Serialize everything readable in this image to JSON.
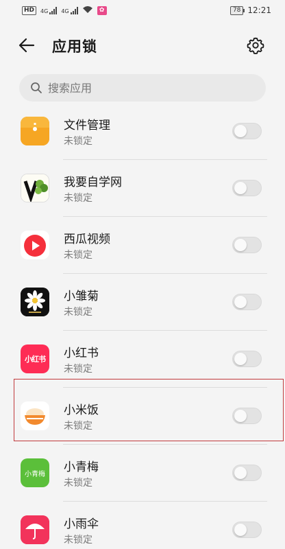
{
  "status_bar": {
    "hd_label": "HD",
    "network_1": "4G",
    "network_2": "4G",
    "battery_level": "78",
    "time": "12:21",
    "notification_badge_color": "#e84a8a"
  },
  "header": {
    "title": "应用锁",
    "back_icon": "arrow-left-icon",
    "settings_icon": "gear-icon"
  },
  "search": {
    "placeholder": "搜索应用",
    "value": ""
  },
  "apps": [
    {
      "name": "文件管理",
      "status": "未锁定",
      "locked": false,
      "icon": "file-manager-icon",
      "icon_color": "#f5a623"
    },
    {
      "name": "我要自学网",
      "status": "未锁定",
      "locked": false,
      "icon": "woyaozixue-icon",
      "icon_color": "#3a7a2c"
    },
    {
      "name": "西瓜视频",
      "status": "未锁定",
      "locked": false,
      "icon": "xigua-video-icon",
      "icon_color": "#f5303c"
    },
    {
      "name": "小雏菊",
      "status": "未锁定",
      "locked": false,
      "icon": "daisy-icon",
      "icon_color": "#111111"
    },
    {
      "name": "小红书",
      "status": "未锁定",
      "locked": false,
      "icon": "xiaohongshu-icon",
      "icon_color": "#fe2c55",
      "icon_text": "小红书"
    },
    {
      "name": "小米饭",
      "status": "未锁定",
      "locked": false,
      "icon": "rice-bowl-icon",
      "icon_color": "#f28a2e",
      "highlighted": true
    },
    {
      "name": "小青梅",
      "status": "未锁定",
      "locked": false,
      "icon": "xiaoqingmei-icon",
      "icon_color": "#5bbf3a",
      "icon_text": "小青梅"
    },
    {
      "name": "小雨伞",
      "status": "未锁定",
      "locked": false,
      "icon": "umbrella-icon",
      "icon_color": "#f2335b"
    }
  ],
  "highlight_color": "#c0393b"
}
